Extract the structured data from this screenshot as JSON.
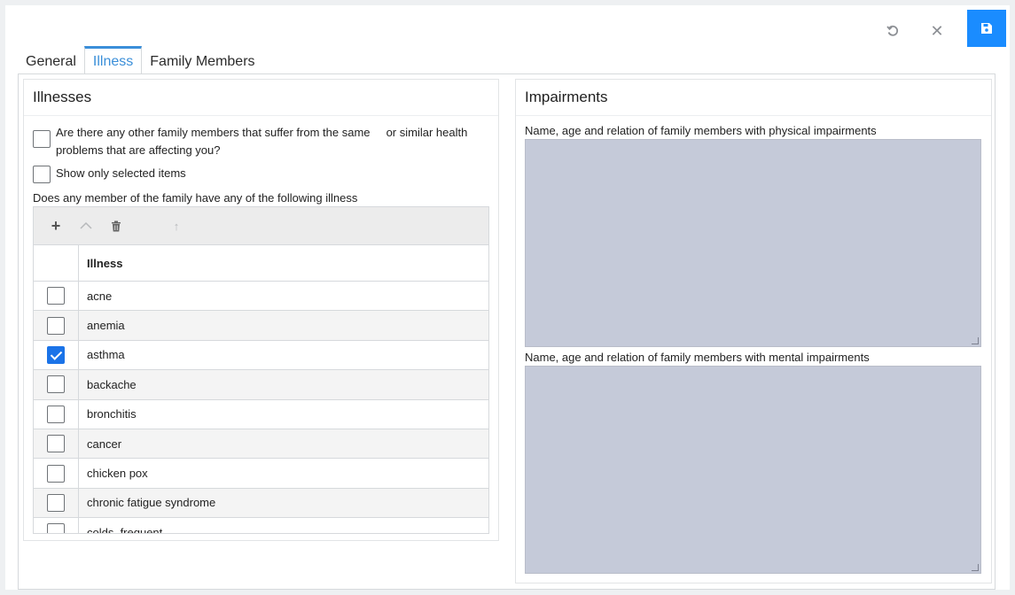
{
  "toolbar": {
    "undo_icon": "undo-icon",
    "close_icon": "close-icon",
    "save_icon": "save-icon"
  },
  "tabs": [
    {
      "label": "General",
      "active": false
    },
    {
      "label": "Illness",
      "active": true
    },
    {
      "label": "Family Members",
      "active": false
    }
  ],
  "illnesses": {
    "title": "Illnesses",
    "question_same_problems": "Are there any other family members that suffer from the same     or similar health problems that are affecting you?",
    "question_checked": false,
    "show_only_selected": "Show only selected items",
    "show_only_selected_checked": false,
    "grid_label": "Does any member of the family have any of the following illness",
    "grid_header": "Illness",
    "rows": [
      {
        "name": "acne",
        "checked": false
      },
      {
        "name": "anemia",
        "checked": false
      },
      {
        "name": "asthma",
        "checked": true
      },
      {
        "name": "backache",
        "checked": false
      },
      {
        "name": "bronchitis",
        "checked": false
      },
      {
        "name": "cancer",
        "checked": false
      },
      {
        "name": "chicken pox",
        "checked": false
      },
      {
        "name": "chronic fatigue syndrome",
        "checked": false
      },
      {
        "name": "colds, frequent",
        "checked": false
      }
    ]
  },
  "impairments": {
    "title": "Impairments",
    "physical_label": "Name, age and relation of family members with physical impairments",
    "physical_value": "",
    "mental_label": "Name, age and relation of family members with mental impairments",
    "mental_value": ""
  },
  "colors": {
    "accent": "#1a8cff",
    "tab_active": "#3b8fd9",
    "textarea_bg": "#c5cad9"
  }
}
